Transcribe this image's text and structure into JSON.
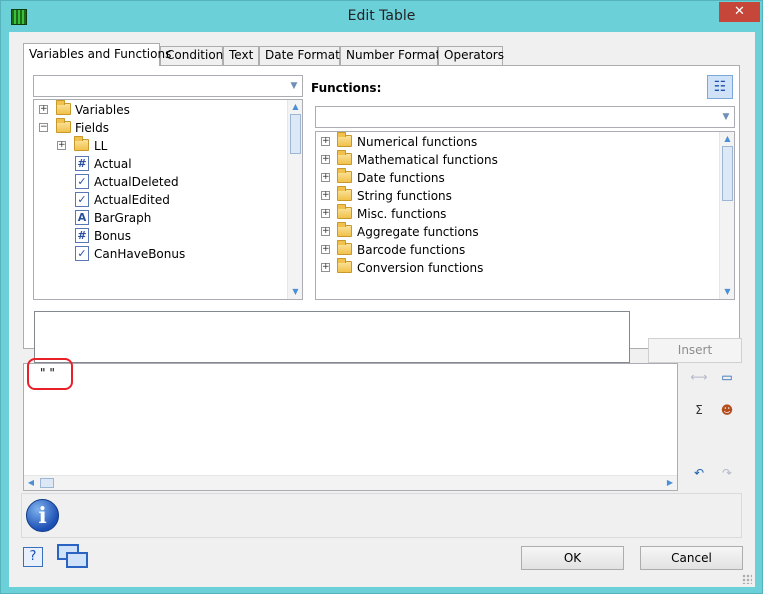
{
  "window": {
    "title": "Edit Table",
    "close_glyph": "✕"
  },
  "tabs": [
    {
      "label": "Variables and Functions",
      "active": true
    },
    {
      "label": "Condition"
    },
    {
      "label": "Text"
    },
    {
      "label": "Date Format"
    },
    {
      "label": "Number Format"
    },
    {
      "label": "Operators"
    }
  ],
  "variables_panel": {
    "filter_value": "",
    "tree": [
      {
        "label": "Variables",
        "expander": "+",
        "icon": "variables-folder-icon"
      },
      {
        "label": "Fields",
        "expander": "−",
        "icon": "fields-folder-icon"
      },
      {
        "label": "LL",
        "expander": "+",
        "icon": "folder-icon"
      },
      {
        "label": "Actual",
        "glyph": "#",
        "icon": "numeric-field-icon"
      },
      {
        "label": "ActualDeleted",
        "glyph": "✓",
        "icon": "boolean-field-icon"
      },
      {
        "label": "ActualEdited",
        "glyph": "✓",
        "icon": "boolean-field-icon"
      },
      {
        "label": "BarGraph",
        "glyph": "A",
        "icon": "text-field-icon"
      },
      {
        "label": "Bonus",
        "glyph": "#",
        "icon": "numeric-field-icon"
      },
      {
        "label": "CanHaveBonus",
        "glyph": "✓",
        "icon": "boolean-field-icon"
      }
    ]
  },
  "functions_panel": {
    "label": "Functions:",
    "filter_value": "",
    "categories": [
      "Numerical functions",
      "Mathematical functions",
      "Date functions",
      "String functions",
      "Misc. functions",
      "Aggregate functions",
      "Barcode functions",
      "Conversion functions"
    ]
  },
  "insert_label": "Insert",
  "editor": {
    "value": "\" \""
  },
  "buttons": {
    "ok": "OK",
    "cancel": "Cancel"
  },
  "colors": {
    "accent_frame": "#6cd0d8",
    "close_button": "#c7463a",
    "highlight": "#e8202a"
  }
}
